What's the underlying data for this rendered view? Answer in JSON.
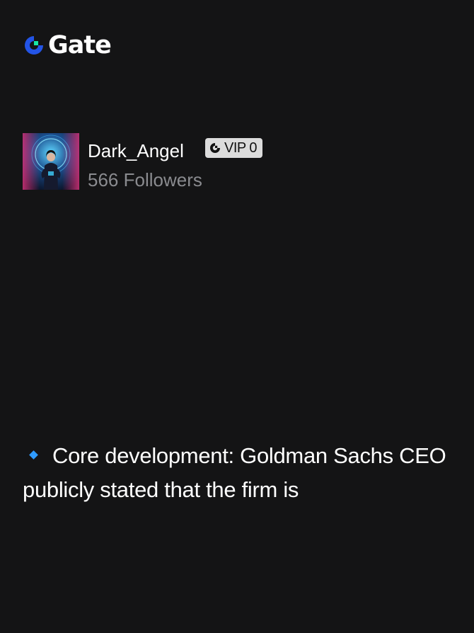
{
  "brand": {
    "name": "Gate",
    "colors": {
      "accent_blue": "#2354e6",
      "accent_green": "#17e5a6"
    }
  },
  "author": {
    "name": "Dark_Angel",
    "vip_label": "VIP 0",
    "followers": "566 Followers"
  },
  "post": {
    "icon": "blue-diamond-icon",
    "text": "Core development: Goldman Sachs CEO publicly stated that the firm is"
  }
}
